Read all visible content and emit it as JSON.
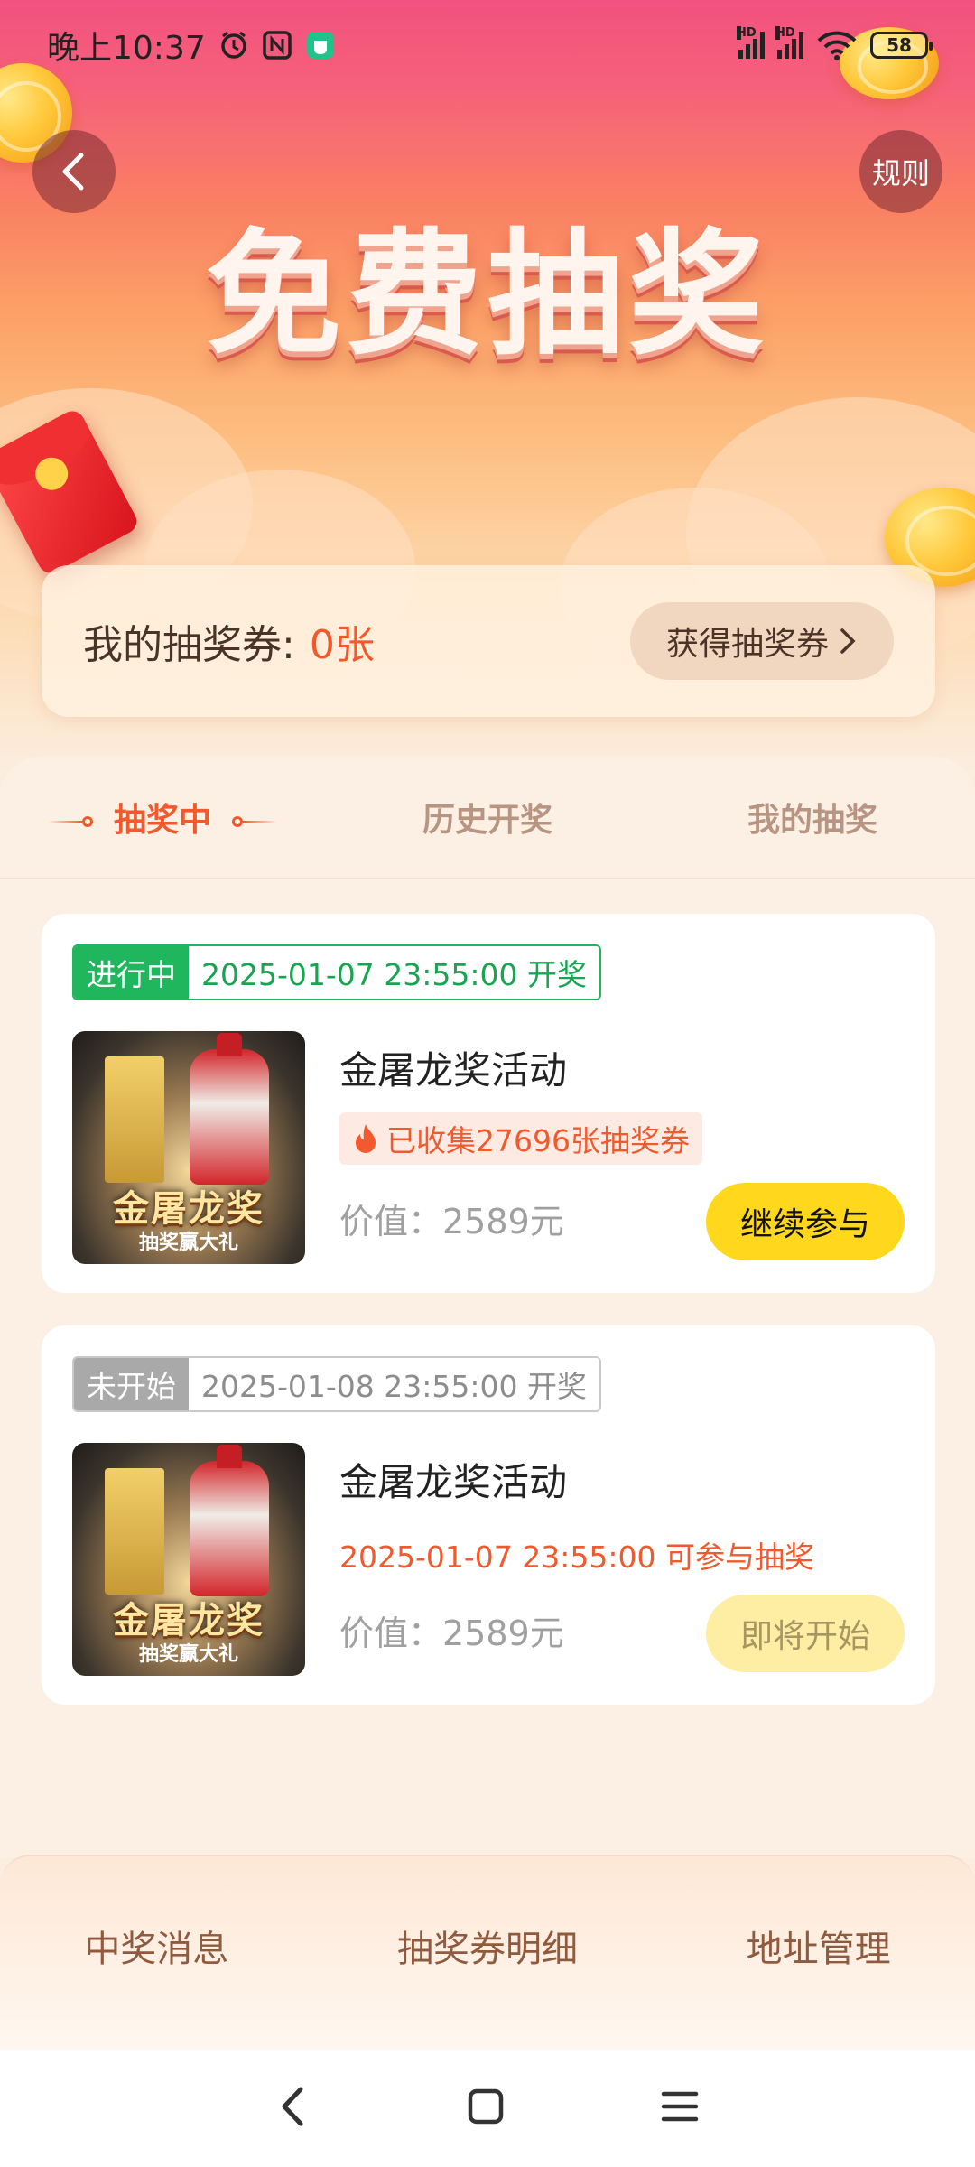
{
  "status_bar": {
    "time": "晚上10:37",
    "battery": "58",
    "network_label": "HD"
  },
  "header": {
    "title": "免费抽奖",
    "rules_label": "规则"
  },
  "tickets": {
    "label": "我的抽奖券:",
    "count": "0张",
    "get_button": "获得抽奖券"
  },
  "tabs": [
    {
      "label": "抽奖中",
      "active": true
    },
    {
      "label": "历史开奖",
      "active": false
    },
    {
      "label": "我的抽奖",
      "active": false
    }
  ],
  "lotteries": [
    {
      "status": "进行中",
      "draw_time": "2025-01-07 23:55:00 开奖",
      "title": "金屠龙奖活动",
      "collected": "已收集27696张抽奖券",
      "value": "价值：2589元",
      "action": "继续参与",
      "image_text": "金屠龙奖",
      "image_subtext": "抽奖赢大礼"
    },
    {
      "status": "未开始",
      "draw_time": "2025-01-08 23:55:00 开奖",
      "title": "金屠龙奖活动",
      "note": "2025-01-07 23:55:00 可参与抽奖",
      "value": "价值：2589元",
      "action": "即将开始",
      "image_text": "金屠龙奖",
      "image_subtext": "抽奖赢大礼"
    }
  ],
  "bottom_menu": {
    "win_messages": "中奖消息",
    "ticket_details": "抽奖券明细",
    "address_management": "地址管理"
  },
  "colors": {
    "accent": "#f05a2e",
    "active_green": "#1fb65e",
    "button_yellow": "#ffd81e"
  },
  "icons": [
    "back-icon",
    "alarm-icon",
    "nfc-icon",
    "app-icon",
    "signal-icon",
    "wifi-icon",
    "battery-icon",
    "fire-icon",
    "chevron-right-icon",
    "nav-back-icon",
    "nav-home-icon",
    "nav-menu-icon"
  ]
}
